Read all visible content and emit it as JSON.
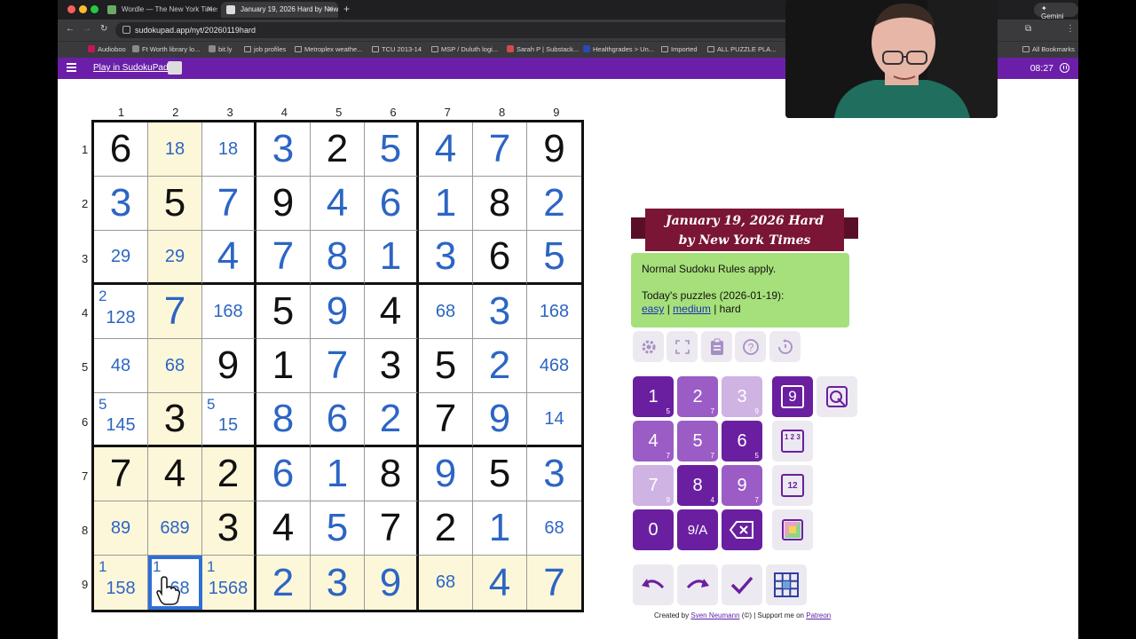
{
  "browser": {
    "tabs": [
      {
        "title": "Wordle — The New York Times",
        "active": false
      },
      {
        "title": "January 19, 2026 Hard by New York Times",
        "active": true
      }
    ],
    "new_tab": "+",
    "gemini_label": "✦ Gemini",
    "url": "sudokupad.app/nyt/20260119hard",
    "bookmarks": [
      "Audioboo",
      "Ft Worth library lo...",
      "bit.ly",
      "job profiles",
      "Metroplex weathe...",
      "TCU 2013-14",
      "MSP / Duluth logi...",
      "Sarah P | Substack...",
      "Healthgrades > Un...",
      "Imported",
      "ALL PUZZLE PLA...",
      "All Bookmarks"
    ]
  },
  "app": {
    "play_link": "Play in SudokuPad",
    "timer": "08:27"
  },
  "grid": {
    "col_labels": [
      "1",
      "2",
      "3",
      "4",
      "5",
      "6",
      "7",
      "8",
      "9"
    ],
    "row_labels": [
      "1",
      "2",
      "3",
      "4",
      "5",
      "6",
      "7",
      "8",
      "9"
    ],
    "cells": [
      [
        {
          "v": "6",
          "t": "given"
        },
        {
          "c": "18"
        },
        {
          "c": "18"
        },
        {
          "v": "3",
          "t": "user"
        },
        {
          "v": "2",
          "t": "given"
        },
        {
          "v": "5",
          "t": "user"
        },
        {
          "v": "4",
          "t": "user"
        },
        {
          "v": "7",
          "t": "user"
        },
        {
          "v": "9",
          "t": "given"
        }
      ],
      [
        {
          "v": "3",
          "t": "user"
        },
        {
          "v": "5",
          "t": "given"
        },
        {
          "v": "7",
          "t": "user"
        },
        {
          "v": "9",
          "t": "given"
        },
        {
          "v": "4",
          "t": "user"
        },
        {
          "v": "6",
          "t": "user"
        },
        {
          "v": "1",
          "t": "user"
        },
        {
          "v": "8",
          "t": "given"
        },
        {
          "v": "2",
          "t": "user"
        }
      ],
      [
        {
          "c": "29"
        },
        {
          "c": "29"
        },
        {
          "v": "4",
          "t": "user"
        },
        {
          "v": "7",
          "t": "user"
        },
        {
          "v": "8",
          "t": "user"
        },
        {
          "v": "1",
          "t": "user"
        },
        {
          "v": "3",
          "t": "user"
        },
        {
          "v": "6",
          "t": "given"
        },
        {
          "v": "5",
          "t": "user"
        }
      ],
      [
        {
          "k": "2",
          "c": "128"
        },
        {
          "v": "7",
          "t": "user"
        },
        {
          "c": "168"
        },
        {
          "v": "5",
          "t": "given"
        },
        {
          "v": "9",
          "t": "user"
        },
        {
          "v": "4",
          "t": "given"
        },
        {
          "c": "68"
        },
        {
          "v": "3",
          "t": "user"
        },
        {
          "c": "168"
        }
      ],
      [
        {
          "c": "48"
        },
        {
          "c": "68"
        },
        {
          "v": "9",
          "t": "given"
        },
        {
          "v": "1",
          "t": "given"
        },
        {
          "v": "7",
          "t": "user"
        },
        {
          "v": "3",
          "t": "given"
        },
        {
          "v": "5",
          "t": "given"
        },
        {
          "v": "2",
          "t": "user"
        },
        {
          "c": "468"
        }
      ],
      [
        {
          "k": "5",
          "c": "145"
        },
        {
          "v": "3",
          "t": "given"
        },
        {
          "k": "5",
          "c": "15"
        },
        {
          "v": "8",
          "t": "user"
        },
        {
          "v": "6",
          "t": "user"
        },
        {
          "v": "2",
          "t": "user"
        },
        {
          "v": "7",
          "t": "given"
        },
        {
          "v": "9",
          "t": "user"
        },
        {
          "c": "14"
        }
      ],
      [
        {
          "v": "7",
          "t": "given"
        },
        {
          "v": "4",
          "t": "given"
        },
        {
          "v": "2",
          "t": "given"
        },
        {
          "v": "6",
          "t": "user"
        },
        {
          "v": "1",
          "t": "user"
        },
        {
          "v": "8",
          "t": "given"
        },
        {
          "v": "9",
          "t": "user"
        },
        {
          "v": "5",
          "t": "given"
        },
        {
          "v": "3",
          "t": "user"
        }
      ],
      [
        {
          "c": "89"
        },
        {
          "c": "689"
        },
        {
          "v": "3",
          "t": "given"
        },
        {
          "v": "4",
          "t": "given"
        },
        {
          "v": "5",
          "t": "user"
        },
        {
          "v": "7",
          "t": "given"
        },
        {
          "v": "2",
          "t": "given"
        },
        {
          "v": "1",
          "t": "user"
        },
        {
          "c": "68"
        }
      ],
      [
        {
          "k": "1",
          "c": "158"
        },
        {
          "k": "1",
          "c": "168"
        },
        {
          "k": "1",
          "c": "1568"
        },
        {
          "v": "2",
          "t": "user"
        },
        {
          "v": "3",
          "t": "user"
        },
        {
          "v": "9",
          "t": "user"
        },
        {
          "c": "68"
        },
        {
          "v": "4",
          "t": "user"
        },
        {
          "v": "7",
          "t": "user"
        }
      ]
    ],
    "highlighted": [
      [
        0,
        1
      ],
      [
        1,
        1
      ],
      [
        2,
        1
      ],
      [
        3,
        1
      ],
      [
        4,
        1
      ],
      [
        5,
        1
      ],
      [
        6,
        0
      ],
      [
        6,
        1
      ],
      [
        6,
        2
      ],
      [
        7,
        0
      ],
      [
        7,
        1
      ],
      [
        7,
        2
      ],
      [
        8,
        0
      ],
      [
        8,
        2
      ],
      [
        8,
        3
      ],
      [
        8,
        4
      ],
      [
        8,
        5
      ],
      [
        8,
        6
      ],
      [
        8,
        7
      ],
      [
        8,
        8
      ]
    ],
    "selected": [
      8,
      1
    ]
  },
  "panel": {
    "title_line1": "January 19, 2026 Hard",
    "title_line2": "by New York Times",
    "rules": "Normal Sudoku Rules apply.",
    "today_label": "Today's puzzles (2026-01-19):",
    "link_easy": "easy",
    "link_medium": "medium",
    "hard_label": "hard",
    "separator": "|",
    "keypad": [
      {
        "label": "1",
        "sub": "5",
        "shade": "dark"
      },
      {
        "label": "2",
        "sub": "7",
        "shade": "mid"
      },
      {
        "label": "3",
        "sub": "9",
        "shade": "light"
      },
      {
        "label": "4",
        "sub": "7",
        "shade": "mid"
      },
      {
        "label": "5",
        "sub": "7",
        "shade": "mid"
      },
      {
        "label": "6",
        "sub": "5",
        "shade": "dark"
      },
      {
        "label": "7",
        "sub": "9",
        "shade": "light"
      },
      {
        "label": "8",
        "sub": "4",
        "shade": "dark"
      },
      {
        "label": "9",
        "sub": "7",
        "shade": "mid"
      },
      {
        "label": "0",
        "sub": "",
        "shade": "dark"
      },
      {
        "label": "9/A",
        "sub": "",
        "shade": "dark"
      }
    ],
    "mode_normal_label": "9",
    "mode_corner_label": "1 2 3",
    "mode_center_label": "12",
    "credits_prefix": "Created by",
    "credits_author": "Sven Neumann",
    "credits_middle": "(©) | Support me on",
    "credits_patreon": "Patreon",
    "accent": "#6a1fa0",
    "ribbon_color": "#7a1535",
    "rules_bg": "#a6e07a",
    "user_digit_color": "#2c65c4"
  }
}
